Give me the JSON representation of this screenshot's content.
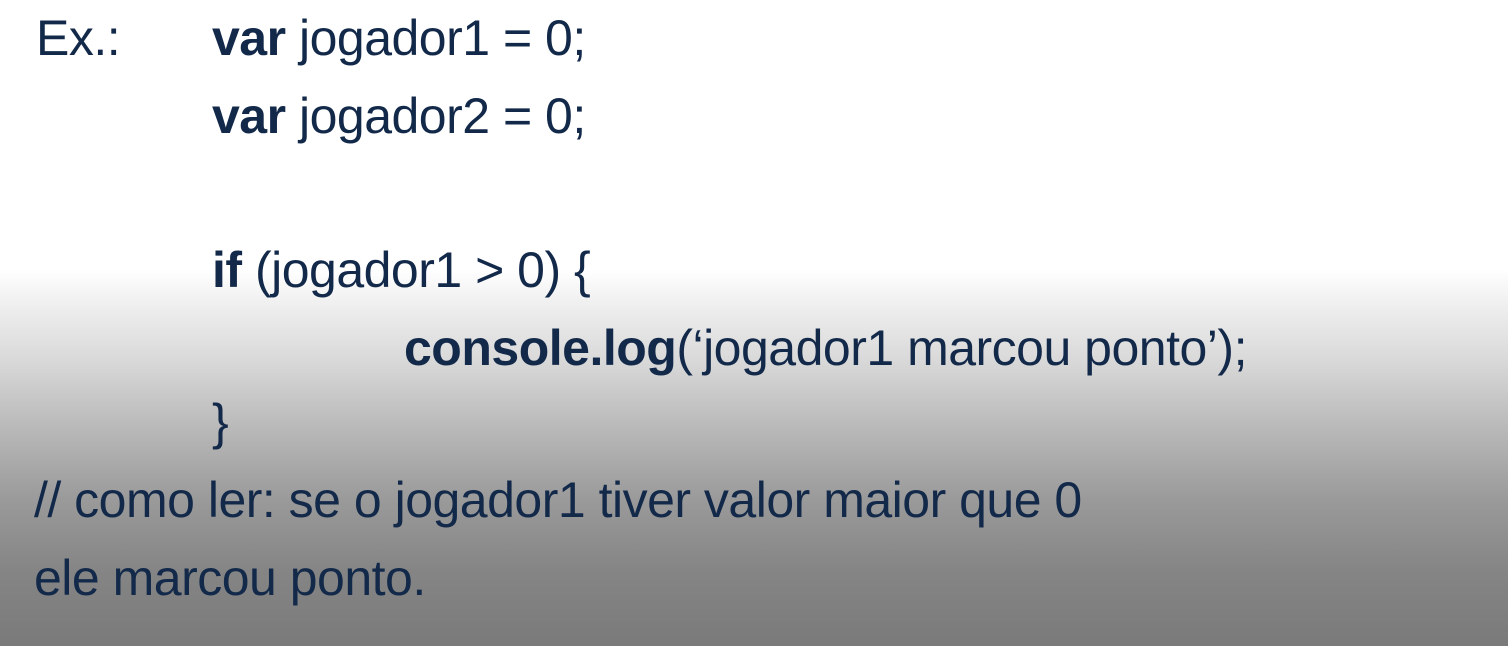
{
  "slide": {
    "example_label": "Ex.:",
    "code": {
      "line1": {
        "keyword": "var",
        "rest": " jogador1 = 0;"
      },
      "line2": {
        "keyword": "var",
        "rest": " jogador2 = 0;"
      },
      "line3": {
        "keyword": "if",
        "rest": " (jogador1 > 0) {"
      },
      "line4": {
        "keyword": "console.log",
        "rest": "(‘jogador1 marcou ponto’);"
      },
      "line5": {
        "text": "}"
      }
    },
    "comment": {
      "line1": "// como ler: se o jogador1 tiver valor maior que 0",
      "line2": "ele marcou ponto."
    }
  },
  "colors": {
    "text": "#13294a",
    "background_top": "#ffffff",
    "background_bottom": "#7a7a7a"
  }
}
